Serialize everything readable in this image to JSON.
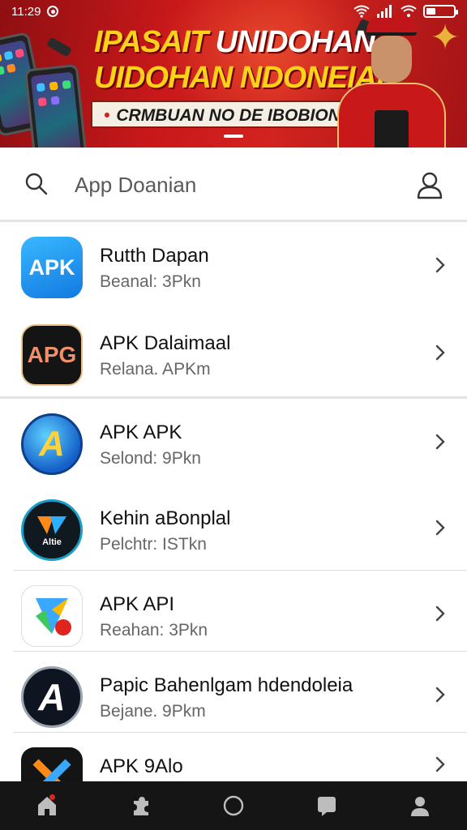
{
  "status_bar": {
    "time": "11:29",
    "battery_level": 0.35,
    "icons": [
      "wifi-icon",
      "signal-icon",
      "wifi-icon",
      "battery-icon"
    ]
  },
  "banner": {
    "title_line1_yellow": "IPASAIT ",
    "title_line1_white": "UNIDOHAN",
    "title_line2": "UIDOHAN NDONEIAI",
    "subtitle": "CRMBUAN NO DE IBOBIONCSI"
  },
  "search": {
    "placeholder": "App Doanian"
  },
  "apps": [
    {
      "name": "Rutth Dapan",
      "sub": "Beanal: 3Pkn",
      "icon_text": "APK",
      "icon": "apk-blue-icon"
    },
    {
      "name": "APK Dalaimaal",
      "sub": "Relana. APKm",
      "icon_text": "APG",
      "icon": "apk-dark-icon"
    },
    {
      "name": "APK  APK",
      "sub": "Selond: 9Pkn",
      "icon_text": "A",
      "icon": "app-store-a-icon"
    },
    {
      "name": "Kehin aBonplal",
      "sub": "Pelchtr: ISTkn",
      "icon_text": "Altie",
      "icon": "kehin-app-icon"
    },
    {
      "name": "APK API",
      "sub": "Reahan: 3Pkn",
      "icon_text": "",
      "icon": "apk-colorful-icon"
    },
    {
      "name": "Papic Bahenlgam hdendoleia",
      "sub": "Bejane. 9Pkm",
      "icon_text": "A",
      "icon": "papic-app-icon"
    },
    {
      "name": "APK 9Alo",
      "sub": "",
      "icon_text": "",
      "icon": "apk-x-icon"
    }
  ],
  "bottom_nav": [
    "home-icon",
    "puzzle-icon",
    "circle-icon",
    "chat-icon",
    "profile-icon"
  ],
  "colors": {
    "banner_red": "#c8181a",
    "banner_yellow": "#ffd21a",
    "nav_bg": "#151515",
    "accent_red": "#e0251e"
  }
}
